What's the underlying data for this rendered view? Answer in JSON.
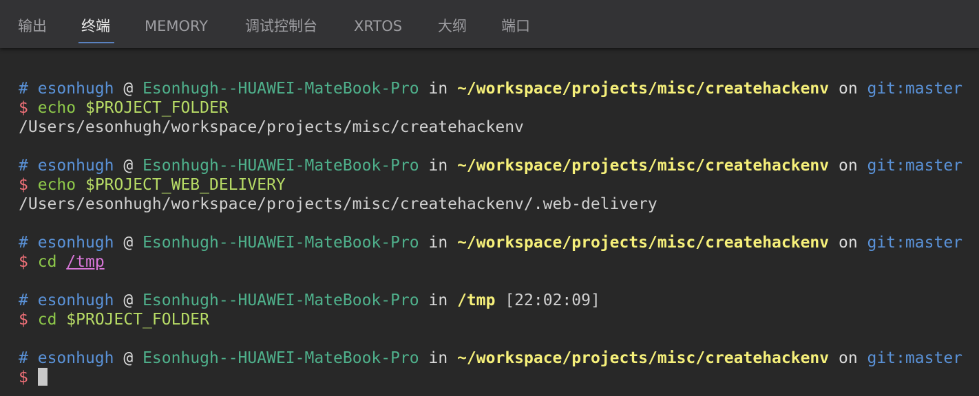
{
  "tabs": [
    {
      "label": "输出"
    },
    {
      "label": "终端"
    },
    {
      "label": "MEMORY"
    },
    {
      "label": "调试控制台"
    },
    {
      "label": "XRTOS"
    },
    {
      "label": "大纲"
    },
    {
      "label": "端口"
    }
  ],
  "active_tab": "终端",
  "prompt": {
    "hash": "#",
    "user": "esonhugh",
    "at": "@",
    "host": "Esonhugh--HUAWEI-MateBook-Pro",
    "in": "in",
    "on": "on",
    "dollar": "$"
  },
  "blocks": [
    {
      "path": "~/workspace/projects/misc/createhackenv",
      "git": "git:master",
      "cmd": "echo",
      "arg": "$PROJECT_FOLDER",
      "output": "/Users/esonhugh/workspace/projects/misc/createhackenv"
    },
    {
      "path": "~/workspace/projects/misc/createhackenv",
      "git": "git:master",
      "cmd": "echo",
      "arg": "$PROJECT_WEB_DELIVERY",
      "output": "/Users/esonhugh/workspace/projects/misc/createhackenv/.web-delivery"
    },
    {
      "path": "~/workspace/projects/misc/createhackenv",
      "git": "git:master",
      "cmd": "cd",
      "arg": "/tmp"
    },
    {
      "path": "/tmp",
      "time": "[22:02:09]",
      "cmd": "cd",
      "arg": "$PROJECT_FOLDER"
    },
    {
      "path": "~/workspace/projects/misc/createhackenv",
      "git": "git:master"
    }
  ],
  "colors": {
    "background": "#282828",
    "tabbar": "#333335",
    "active_underline": "#5a82c0",
    "user": "#5a92d8",
    "host": "#4fb18c",
    "path": "#f6f07a",
    "dollar": "#f07078",
    "command": "#8ec94a"
  }
}
